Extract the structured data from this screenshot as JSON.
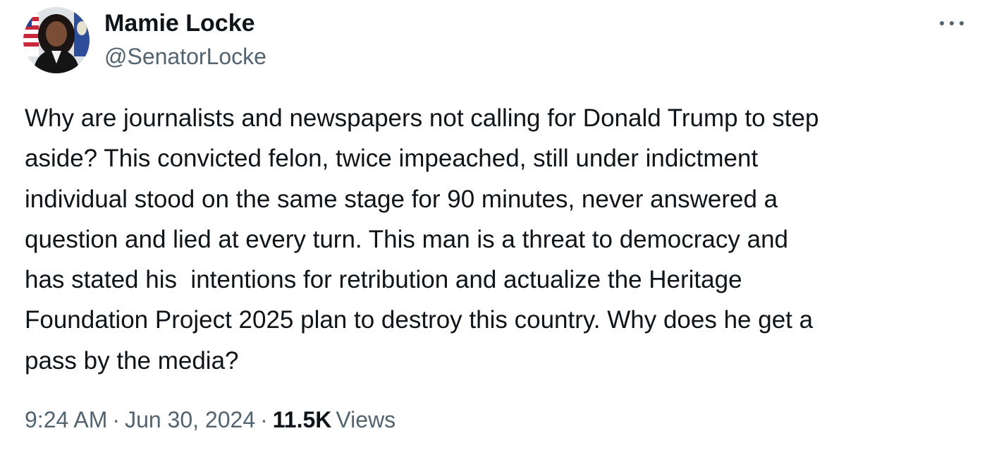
{
  "author": {
    "display_name": "Mamie Locke",
    "handle": "@SenatorLocke",
    "avatar_icon": "profile-photo-icon"
  },
  "more_icon": "more-options-icon",
  "tweet": {
    "text": "Why are journalists and newspapers not calling for Donald Trump to step\naside? This convicted felon, twice impeached, still under indictment\nindividual stood on the same stage for 90 minutes, never answered a\nquestion and lied at every turn. This man is a threat to democracy and\nhas stated his  intentions for retribution and actualize the Heritage\nFoundation Project 2025 plan to destroy this country. Why does he get a\npass by the media?"
  },
  "meta": {
    "time": "9:24 AM",
    "separator": "·",
    "date": "Jun 30, 2024",
    "views_count": "11.5K",
    "views_label": "Views"
  },
  "colors": {
    "text_primary": "#0f1419",
    "text_secondary": "#536471",
    "background": "#ffffff"
  }
}
